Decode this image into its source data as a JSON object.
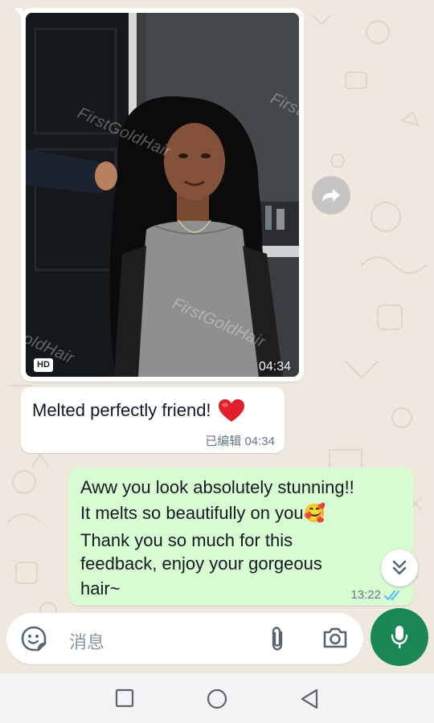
{
  "media_message": {
    "badge": "HD",
    "duration": "04:34",
    "watermark": "FirstGoldHair"
  },
  "incoming_message": {
    "text": "Melted perfectly friend!",
    "emoji": "❤️",
    "meta": "已编辑 04:34"
  },
  "outgoing_message": {
    "lines": [
      "Aww you look absolutely stunning!!",
      "It melts so beautifully on you🥰",
      "Thank you so much for this",
      "feedback, enjoy your gorgeous",
      "hair~"
    ],
    "time": "13:22",
    "status_icon": "double-check-read-icon"
  },
  "composer": {
    "placeholder": "消息"
  },
  "colors": {
    "incoming_bubble": "#ffffff",
    "outgoing_bubble": "#d9fdd3",
    "accent_green": "#1b8755",
    "read_tick_blue": "#53bdeb",
    "wallpaper": "#efe8df"
  },
  "icons": {
    "forward": "forward-icon",
    "scroll_down": "double-chevron-down-icon",
    "emoji": "sticker-icon",
    "attach": "paperclip-icon",
    "camera": "camera-icon",
    "mic": "microphone-icon",
    "nav_recent": "square-icon",
    "nav_home": "circle-icon",
    "nav_back": "triangle-back-icon"
  }
}
